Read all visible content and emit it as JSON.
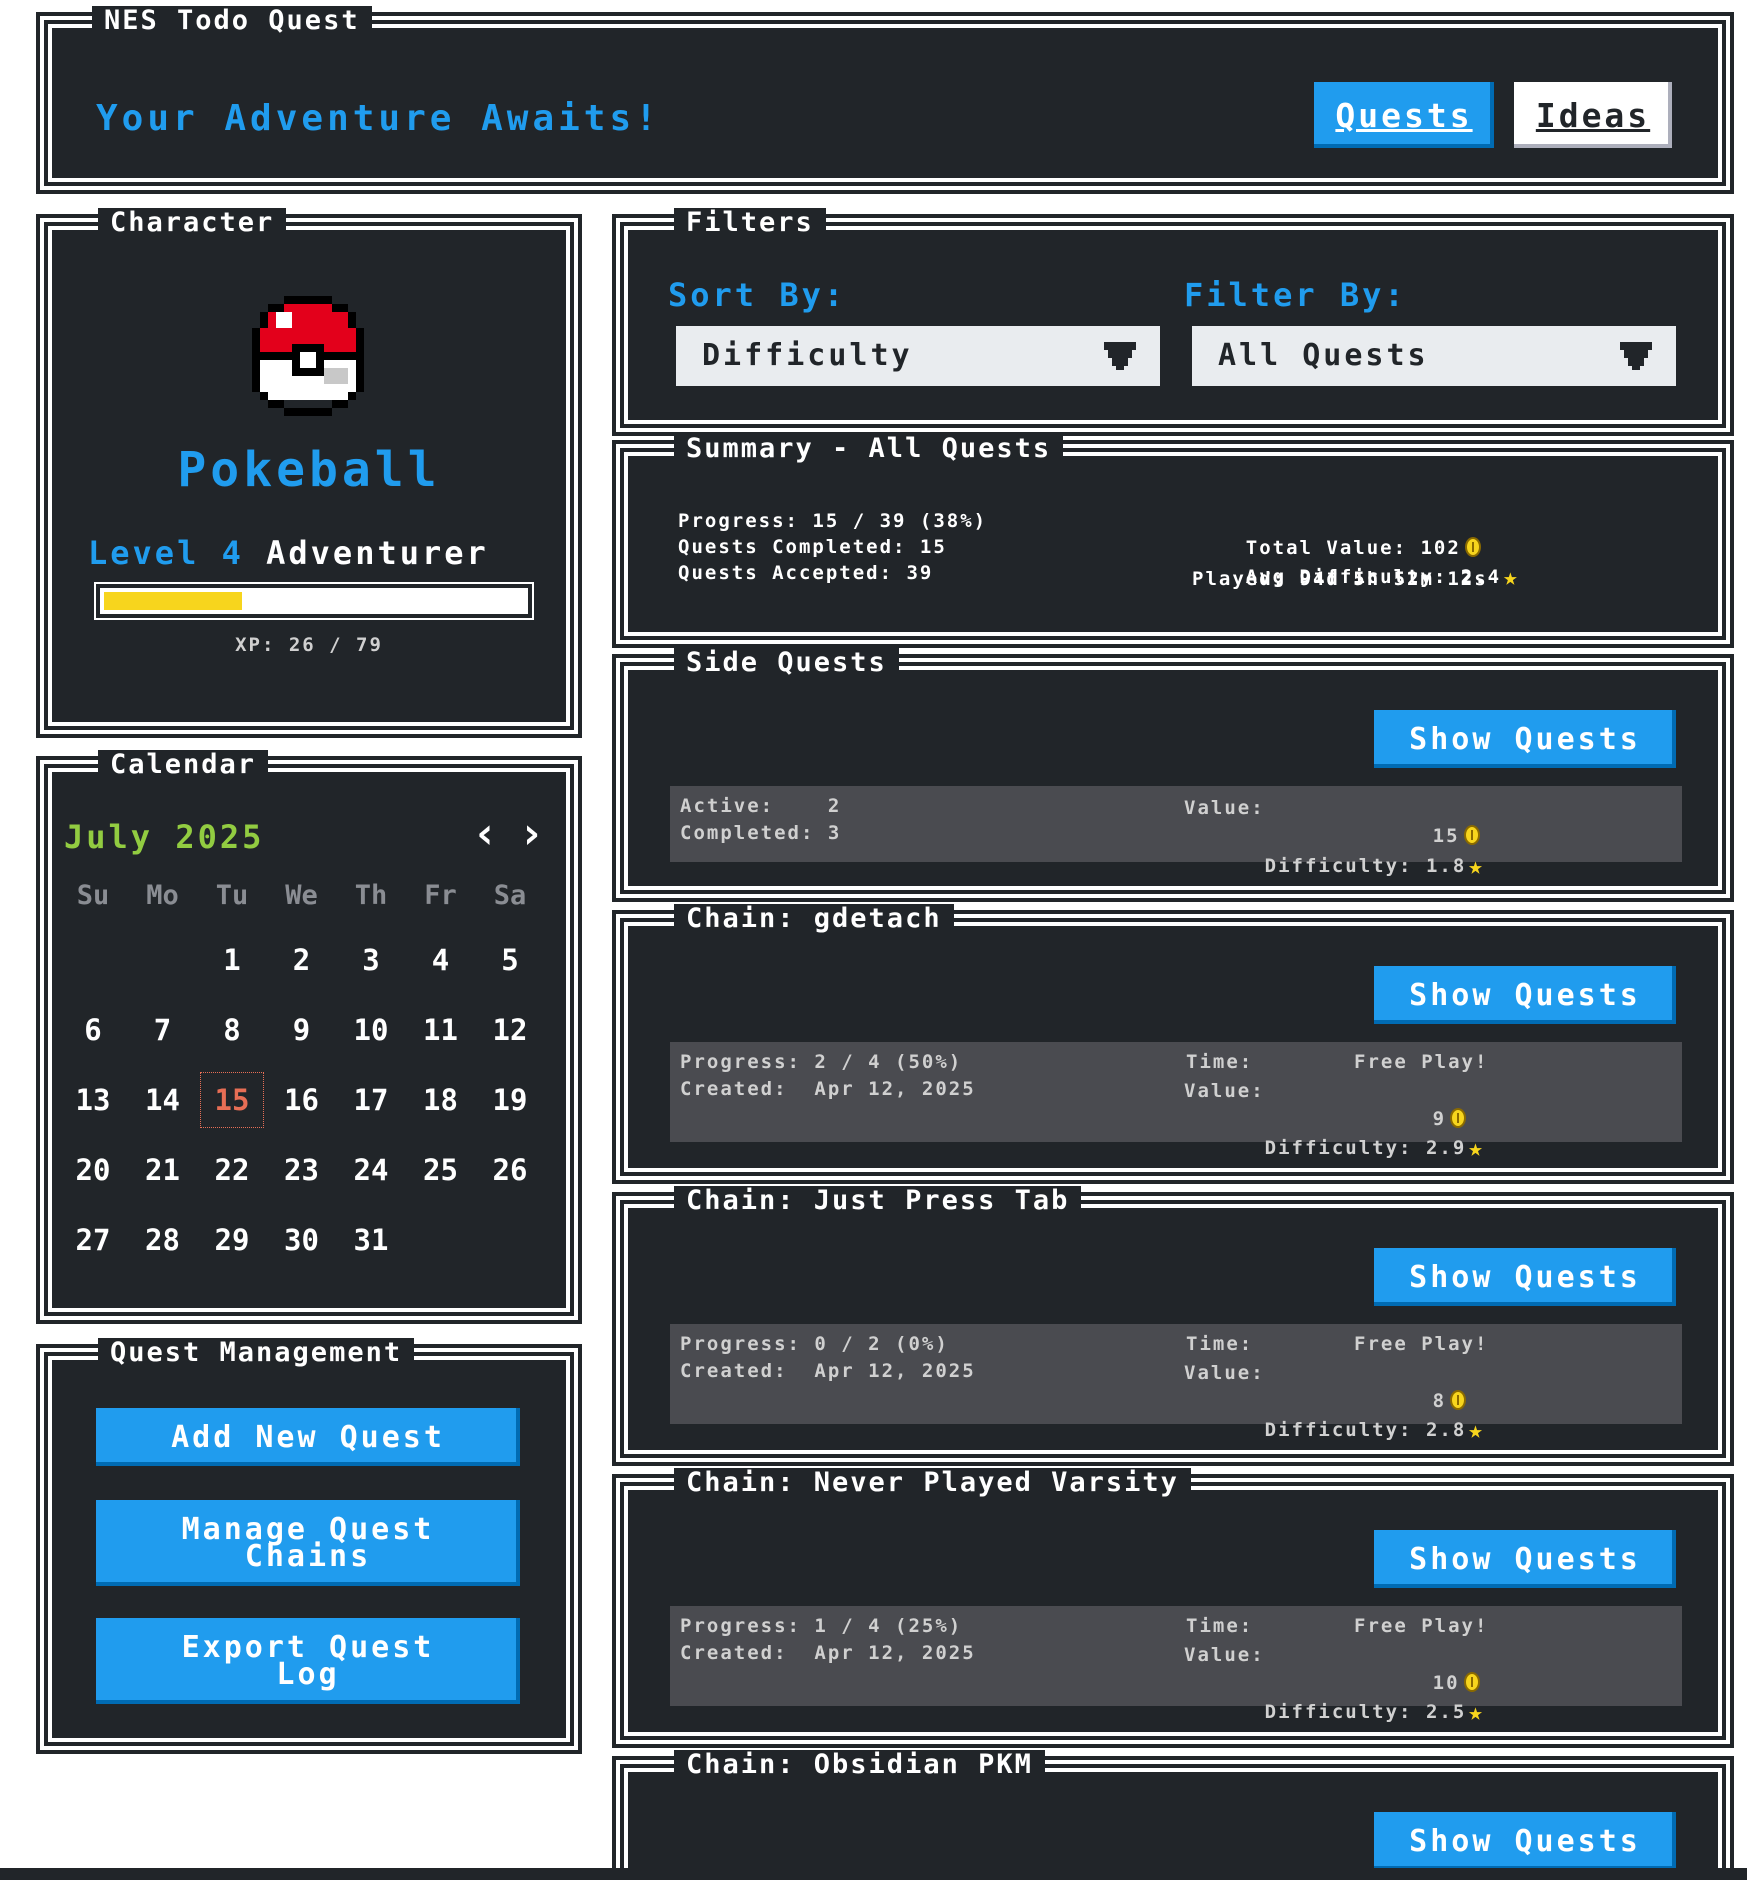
{
  "header": {
    "title": "NES Todo Quest",
    "tagline": "Your Adventure Awaits!",
    "nav_quests": "Quests",
    "nav_ideas": "Ideas"
  },
  "character": {
    "title": "Character",
    "name": "Pokeball",
    "level_label": "Level 4",
    "class_label": "Adventurer",
    "xp_text": "XP: 26 / 79",
    "xp_current": 26,
    "xp_max": 79,
    "avatar_icon": "pokeball-icon"
  },
  "calendar": {
    "title": "Calendar",
    "month_label": "July 2025",
    "prev_icon": "‹",
    "next_icon": "›",
    "weekdays": [
      "Su",
      "Mo",
      "Tu",
      "We",
      "Th",
      "Fr",
      "Sa"
    ],
    "weeks": [
      [
        "",
        "",
        "1",
        "2",
        "3",
        "4",
        "5"
      ],
      [
        "6",
        "7",
        "8",
        "9",
        "10",
        "11",
        "12"
      ],
      [
        "13",
        "14",
        "15",
        "16",
        "17",
        "18",
        "19"
      ],
      [
        "20",
        "21",
        "22",
        "23",
        "24",
        "25",
        "26"
      ],
      [
        "27",
        "28",
        "29",
        "30",
        "31",
        "",
        ""
      ]
    ],
    "today": "15"
  },
  "management": {
    "title": "Quest Management",
    "add_label": "Add New Quest",
    "manage_label_1": "Manage Quest",
    "manage_label_2": "Chains",
    "export_label_1": "Export Quest",
    "export_label_2": "Log"
  },
  "filters": {
    "title": "Filters",
    "sort_label": "Sort By:",
    "sort_value": "Difficulty",
    "filter_label": "Filter By:",
    "filter_value": "All Quests"
  },
  "summary": {
    "title": "Summary - All Quests",
    "progress": "Progress: 15 / 39 (38%)",
    "completed": "Quests Completed: 15",
    "accepted": "Quests Accepted: 39",
    "total_value": "Total Value: 102",
    "avg_difficulty": "Avg Difficulty: 2.4",
    "played": "Played: 94d 5h 52m 12s"
  },
  "side_quests": {
    "title": "Side Quests",
    "button": "Show Quests",
    "active": "Active:    2",
    "completed": "Completed: 3",
    "value_label": "Value:",
    "value": "15",
    "difficulty_label": "Difficulty:",
    "difficulty": "1.8"
  },
  "chains": [
    {
      "title": "Chain: gdetach",
      "button": "Show Quests",
      "progress": "Progress: 2 / 4 (50%)",
      "created": "Created:  Apr 12, 2025",
      "time_label": "Time:",
      "time": "Free Play!",
      "value_label": "Value:",
      "value": "9",
      "difficulty_label": "Difficulty:",
      "difficulty": "2.9"
    },
    {
      "title": "Chain: Just Press Tab",
      "button": "Show Quests",
      "progress": "Progress: 0 / 2 (0%)",
      "created": "Created:  Apr 12, 2025",
      "time_label": "Time:",
      "time": "Free Play!",
      "value_label": "Value:",
      "value": "8",
      "difficulty_label": "Difficulty:",
      "difficulty": "2.8"
    },
    {
      "title": "Chain: Never Played Varsity",
      "button": "Show Quests",
      "progress": "Progress: 1 / 4 (25%)",
      "created": "Created:  Apr 12, 2025",
      "time_label": "Time:",
      "time": "Free Play!",
      "value_label": "Value:",
      "value": "10",
      "difficulty_label": "Difficulty:",
      "difficulty": "2.5"
    },
    {
      "title": "Chain: Obsidian PKM",
      "button": "Show Quests"
    }
  ],
  "colors": {
    "accent": "#209cee",
    "panel": "#212529",
    "xp_bar": "#f7d51d",
    "today": "#e76e55",
    "month": "#92cc41"
  },
  "icons": {
    "coin": "coin-icon",
    "star": "star-icon",
    "dropdown": "chevron-down-icon"
  }
}
